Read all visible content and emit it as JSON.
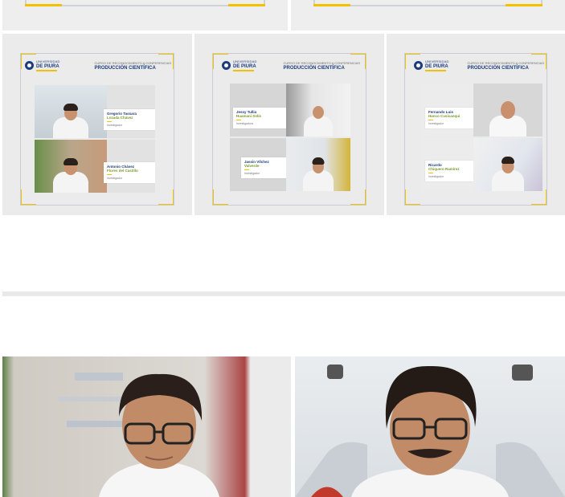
{
  "gallery": {
    "title_small": "CURSO DE RECONOCIMIENTO A CONFERENCIAS",
    "title_big": "PRODUCCIÓN CIENTÍFICA",
    "university_small": "UNIVERSIDAD",
    "university_big": "DE PIURA",
    "accent_color": "#f2c200",
    "brand_color": "#1d3c7a",
    "cards": [
      {
        "people": [
          {
            "name": "Gregorio Tassara",
            "surname": "Lozada Chávez",
            "desc": "Investigador"
          },
          {
            "name": "Antonio Chávez",
            "surname": "Flores del Castillo",
            "desc": "Investigador"
          }
        ]
      },
      {
        "people": [
          {
            "name": "Jessy Tullia",
            "surname": "Huamani Solís",
            "desc": "Investigadora"
          },
          {
            "name": "Jassin Vílchez",
            "surname": "Valverde",
            "desc": "Investigador"
          }
        ]
      },
      {
        "people": [
          {
            "name": "Fernando Luis",
            "surname": "Hanco Cusicanqui",
            "desc": "Investigador"
          },
          {
            "name": "Ricardo",
            "surname": "Chiquero Ramírez",
            "desc": "Investigador"
          }
        ]
      }
    ]
  },
  "icons": {
    "seal": "university-seal-icon"
  }
}
